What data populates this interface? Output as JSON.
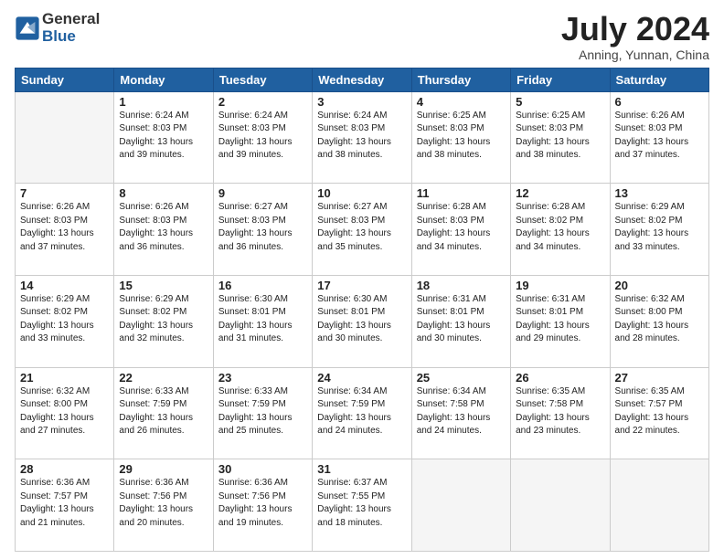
{
  "logo": {
    "general": "General",
    "blue": "Blue"
  },
  "title": "July 2024",
  "subtitle": "Anning, Yunnan, China",
  "days_of_week": [
    "Sunday",
    "Monday",
    "Tuesday",
    "Wednesday",
    "Thursday",
    "Friday",
    "Saturday"
  ],
  "weeks": [
    [
      {
        "day": "",
        "info": ""
      },
      {
        "day": "1",
        "info": "Sunrise: 6:24 AM\nSunset: 8:03 PM\nDaylight: 13 hours\nand 39 minutes."
      },
      {
        "day": "2",
        "info": "Sunrise: 6:24 AM\nSunset: 8:03 PM\nDaylight: 13 hours\nand 39 minutes."
      },
      {
        "day": "3",
        "info": "Sunrise: 6:24 AM\nSunset: 8:03 PM\nDaylight: 13 hours\nand 38 minutes."
      },
      {
        "day": "4",
        "info": "Sunrise: 6:25 AM\nSunset: 8:03 PM\nDaylight: 13 hours\nand 38 minutes."
      },
      {
        "day": "5",
        "info": "Sunrise: 6:25 AM\nSunset: 8:03 PM\nDaylight: 13 hours\nand 38 minutes."
      },
      {
        "day": "6",
        "info": "Sunrise: 6:26 AM\nSunset: 8:03 PM\nDaylight: 13 hours\nand 37 minutes."
      }
    ],
    [
      {
        "day": "7",
        "info": "Sunrise: 6:26 AM\nSunset: 8:03 PM\nDaylight: 13 hours\nand 37 minutes."
      },
      {
        "day": "8",
        "info": "Sunrise: 6:26 AM\nSunset: 8:03 PM\nDaylight: 13 hours\nand 36 minutes."
      },
      {
        "day": "9",
        "info": "Sunrise: 6:27 AM\nSunset: 8:03 PM\nDaylight: 13 hours\nand 36 minutes."
      },
      {
        "day": "10",
        "info": "Sunrise: 6:27 AM\nSunset: 8:03 PM\nDaylight: 13 hours\nand 35 minutes."
      },
      {
        "day": "11",
        "info": "Sunrise: 6:28 AM\nSunset: 8:03 PM\nDaylight: 13 hours\nand 34 minutes."
      },
      {
        "day": "12",
        "info": "Sunrise: 6:28 AM\nSunset: 8:02 PM\nDaylight: 13 hours\nand 34 minutes."
      },
      {
        "day": "13",
        "info": "Sunrise: 6:29 AM\nSunset: 8:02 PM\nDaylight: 13 hours\nand 33 minutes."
      }
    ],
    [
      {
        "day": "14",
        "info": "Sunrise: 6:29 AM\nSunset: 8:02 PM\nDaylight: 13 hours\nand 33 minutes."
      },
      {
        "day": "15",
        "info": "Sunrise: 6:29 AM\nSunset: 8:02 PM\nDaylight: 13 hours\nand 32 minutes."
      },
      {
        "day": "16",
        "info": "Sunrise: 6:30 AM\nSunset: 8:01 PM\nDaylight: 13 hours\nand 31 minutes."
      },
      {
        "day": "17",
        "info": "Sunrise: 6:30 AM\nSunset: 8:01 PM\nDaylight: 13 hours\nand 30 minutes."
      },
      {
        "day": "18",
        "info": "Sunrise: 6:31 AM\nSunset: 8:01 PM\nDaylight: 13 hours\nand 30 minutes."
      },
      {
        "day": "19",
        "info": "Sunrise: 6:31 AM\nSunset: 8:01 PM\nDaylight: 13 hours\nand 29 minutes."
      },
      {
        "day": "20",
        "info": "Sunrise: 6:32 AM\nSunset: 8:00 PM\nDaylight: 13 hours\nand 28 minutes."
      }
    ],
    [
      {
        "day": "21",
        "info": "Sunrise: 6:32 AM\nSunset: 8:00 PM\nDaylight: 13 hours\nand 27 minutes."
      },
      {
        "day": "22",
        "info": "Sunrise: 6:33 AM\nSunset: 7:59 PM\nDaylight: 13 hours\nand 26 minutes."
      },
      {
        "day": "23",
        "info": "Sunrise: 6:33 AM\nSunset: 7:59 PM\nDaylight: 13 hours\nand 25 minutes."
      },
      {
        "day": "24",
        "info": "Sunrise: 6:34 AM\nSunset: 7:59 PM\nDaylight: 13 hours\nand 24 minutes."
      },
      {
        "day": "25",
        "info": "Sunrise: 6:34 AM\nSunset: 7:58 PM\nDaylight: 13 hours\nand 24 minutes."
      },
      {
        "day": "26",
        "info": "Sunrise: 6:35 AM\nSunset: 7:58 PM\nDaylight: 13 hours\nand 23 minutes."
      },
      {
        "day": "27",
        "info": "Sunrise: 6:35 AM\nSunset: 7:57 PM\nDaylight: 13 hours\nand 22 minutes."
      }
    ],
    [
      {
        "day": "28",
        "info": "Sunrise: 6:36 AM\nSunset: 7:57 PM\nDaylight: 13 hours\nand 21 minutes."
      },
      {
        "day": "29",
        "info": "Sunrise: 6:36 AM\nSunset: 7:56 PM\nDaylight: 13 hours\nand 20 minutes."
      },
      {
        "day": "30",
        "info": "Sunrise: 6:36 AM\nSunset: 7:56 PM\nDaylight: 13 hours\nand 19 minutes."
      },
      {
        "day": "31",
        "info": "Sunrise: 6:37 AM\nSunset: 7:55 PM\nDaylight: 13 hours\nand 18 minutes."
      },
      {
        "day": "",
        "info": ""
      },
      {
        "day": "",
        "info": ""
      },
      {
        "day": "",
        "info": ""
      }
    ]
  ]
}
